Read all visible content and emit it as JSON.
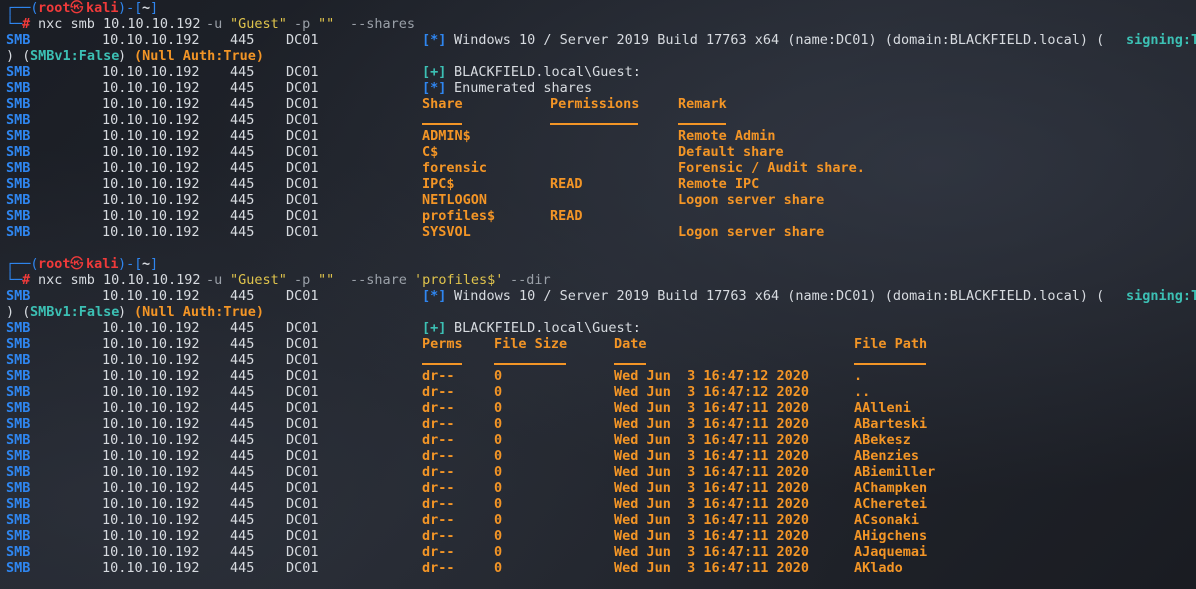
{
  "prompt": {
    "user": "root",
    "at": "㉿",
    "host": "kali",
    "dir": "~",
    "symbol": "#"
  },
  "cmd1": {
    "bin": "nxc smb 10.10.10.192",
    "u_flag": "-u",
    "u_val": "\"Guest\"",
    "p_flag": "-p",
    "p_val": "\"\"",
    "opt": "--shares"
  },
  "cmd2": {
    "bin": "nxc smb 10.10.10.192",
    "u_flag": "-u",
    "u_val": "\"Guest\"",
    "p_flag": "-p",
    "p_val": "\"\"",
    "opt": "--share",
    "opt_val": "'profiles$'",
    "opt2": "--dir"
  },
  "host": {
    "proto": "SMB",
    "ip": "10.10.10.192",
    "port": "445",
    "name": "DC01"
  },
  "info": {
    "tag": "[*]",
    "text": "Windows 10 / Server 2019 Build 17763 x64 (name:DC01) (domain:BLACKFIELD.local) (",
    "signing": "signing:True",
    "wrap_open": ") (",
    "smbv1": "SMBv1:False",
    "wrap_mid": ") ",
    "nullauth": "(Null Auth:True)"
  },
  "auth": {
    "tag": "[+]",
    "text": "BLACKFIELD.local\\Guest:"
  },
  "enum": {
    "tag": "[*]",
    "text": "Enumerated shares"
  },
  "shares_headers": [
    "Share",
    "Permissions",
    "Remark"
  ],
  "shares_dashes": [
    "-----",
    "-----------",
    "------"
  ],
  "shares": [
    {
      "share": "ADMIN$",
      "perm": "",
      "remark": "Remote Admin"
    },
    {
      "share": "C$",
      "perm": "",
      "remark": "Default share"
    },
    {
      "share": "forensic",
      "perm": "",
      "remark": "Forensic / Audit share."
    },
    {
      "share": "IPC$",
      "perm": "READ",
      "remark": "Remote IPC"
    },
    {
      "share": "NETLOGON",
      "perm": "",
      "remark": "Logon server share"
    },
    {
      "share": "profiles$",
      "perm": "READ",
      "remark": ""
    },
    {
      "share": "SYSVOL",
      "perm": "",
      "remark": "Logon server share"
    }
  ],
  "dir_headers": [
    "Perms",
    "File Size",
    "Date",
    "File Path"
  ],
  "dir_rows": [
    {
      "perm": "dr--",
      "size": "0",
      "date": "Wed Jun  3 16:47:12 2020",
      "path": "."
    },
    {
      "perm": "dr--",
      "size": "0",
      "date": "Wed Jun  3 16:47:12 2020",
      "path": ".."
    },
    {
      "perm": "dr--",
      "size": "0",
      "date": "Wed Jun  3 16:47:11 2020",
      "path": "AAlleni"
    },
    {
      "perm": "dr--",
      "size": "0",
      "date": "Wed Jun  3 16:47:11 2020",
      "path": "ABarteski"
    },
    {
      "perm": "dr--",
      "size": "0",
      "date": "Wed Jun  3 16:47:11 2020",
      "path": "ABekesz"
    },
    {
      "perm": "dr--",
      "size": "0",
      "date": "Wed Jun  3 16:47:11 2020",
      "path": "ABenzies"
    },
    {
      "perm": "dr--",
      "size": "0",
      "date": "Wed Jun  3 16:47:11 2020",
      "path": "ABiemiller"
    },
    {
      "perm": "dr--",
      "size": "0",
      "date": "Wed Jun  3 16:47:11 2020",
      "path": "AChampken"
    },
    {
      "perm": "dr--",
      "size": "0",
      "date": "Wed Jun  3 16:47:11 2020",
      "path": "ACheretei"
    },
    {
      "perm": "dr--",
      "size": "0",
      "date": "Wed Jun  3 16:47:11 2020",
      "path": "ACsonaki"
    },
    {
      "perm": "dr--",
      "size": "0",
      "date": "Wed Jun  3 16:47:11 2020",
      "path": "AHigchens"
    },
    {
      "perm": "dr--",
      "size": "0",
      "date": "Wed Jun  3 16:47:11 2020",
      "path": "AJaquemai"
    },
    {
      "perm": "dr--",
      "size": "0",
      "date": "Wed Jun  3 16:47:11 2020",
      "path": "AKlado"
    }
  ],
  "colors": {
    "background": "#1c1f27",
    "smb_blue": "#2f86f0",
    "prompt_red": "#f03a3a",
    "string_yellow": "#e0c44c",
    "result_orange": "#f39526",
    "status_teal": "#3cc0b4"
  }
}
